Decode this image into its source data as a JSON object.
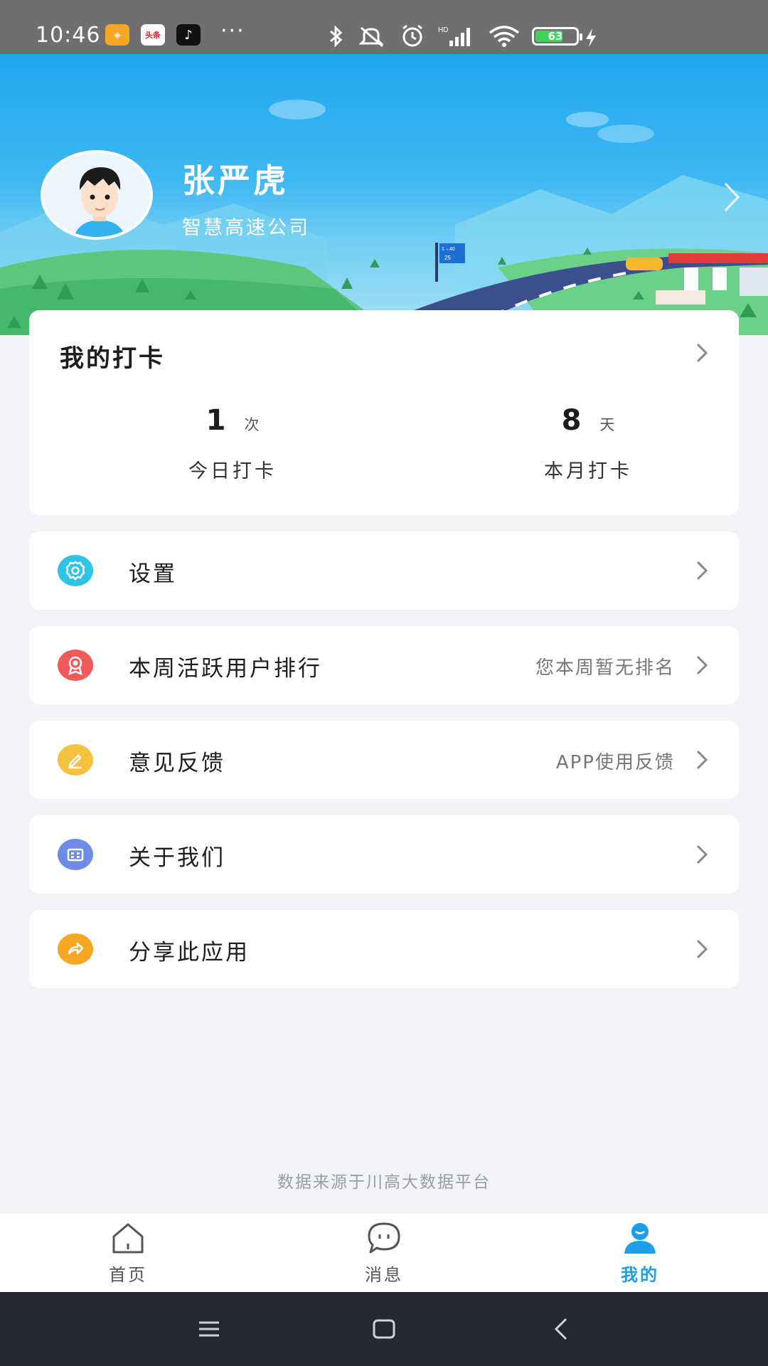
{
  "status_bar": {
    "time": "10:46",
    "app_badges": [
      "头条"
    ],
    "more": "···",
    "battery": "63"
  },
  "profile": {
    "name": "张严虎",
    "company": "智慧高速公司",
    "sign_text": [
      "1→40",
      "25"
    ]
  },
  "checkin": {
    "title": "我的打卡",
    "today_value": "1",
    "today_unit": "次",
    "today_label": "今日打卡",
    "month_value": "8",
    "month_unit": "天",
    "month_label": "本月打卡"
  },
  "menu": [
    {
      "label": "设置",
      "extra": "",
      "icon": "gear-icon",
      "color": "#2ec4e6"
    },
    {
      "label": "本周活跃用户排行",
      "extra": "您本周暂无排名",
      "icon": "award-icon",
      "color": "#f05a5a"
    },
    {
      "label": "意见反馈",
      "extra": "APP使用反馈",
      "icon": "pen-icon",
      "color": "#f6c23e"
    },
    {
      "label": "关于我们",
      "extra": "",
      "icon": "building-icon",
      "color": "#6f8be8"
    },
    {
      "label": "分享此应用",
      "extra": "",
      "icon": "share-icon",
      "color": "#f5a623"
    }
  ],
  "footer_note": "数据来源于川高大数据平台",
  "tabs": [
    {
      "label": "首页",
      "icon": "home-icon",
      "active": false
    },
    {
      "label": "消息",
      "icon": "message-icon",
      "active": false
    },
    {
      "label": "我的",
      "icon": "user-icon",
      "active": true
    }
  ],
  "colors": {
    "accent": "#1ba0e8",
    "banner_top": "#1fa7ef",
    "page_bg": "#f2f3f7"
  }
}
